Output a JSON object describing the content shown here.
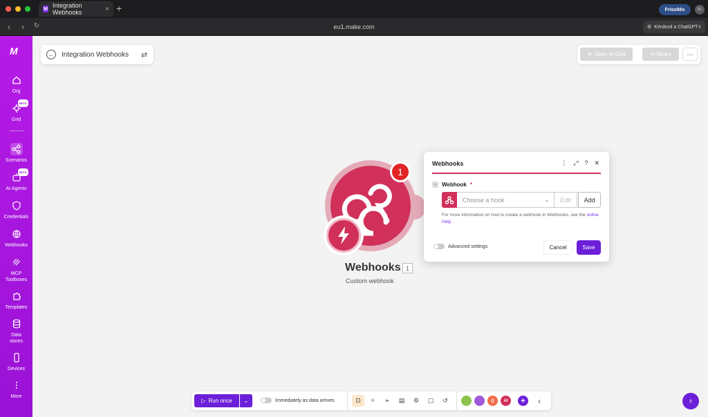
{
  "browser": {
    "tab_title": "Integration Webhooks",
    "favicon_text": "M",
    "url": "eu1.make.com",
    "update_button": "Frissítés",
    "profile_initials": "DL",
    "chatgpt_button": "Kérdezd a ChatGPT-t"
  },
  "sidebar": {
    "items": [
      {
        "label": "Org",
        "icon": "house-icon"
      },
      {
        "label": "Grid",
        "icon": "grid-icon",
        "badge": "BETA"
      },
      {
        "label": "Scenarios",
        "icon": "share-nodes-icon"
      },
      {
        "label": "AI Agents",
        "icon": "robot-icon",
        "badge": "BETA"
      },
      {
        "label": "Credentials",
        "icon": "shield-icon"
      },
      {
        "label": "Webhooks",
        "icon": "globe-icon"
      },
      {
        "label": "MCP Toolboxes",
        "icon": "mcp-icon"
      },
      {
        "label": "Templates",
        "icon": "puzzle-icon"
      },
      {
        "label": "Data stores",
        "icon": "database-icon"
      },
      {
        "label": "Devices",
        "icon": "phone-icon"
      },
      {
        "label": "More",
        "icon": "more-vertical-icon"
      }
    ]
  },
  "header": {
    "scenario_title": "Integration Webhooks",
    "open_in_grid": "Open in Grid",
    "share": "Share",
    "more": "···"
  },
  "module": {
    "name": "Webhooks",
    "number": "1",
    "subtitle": "Custom webhook",
    "run_badge": "1",
    "color": "#d0305a"
  },
  "dialog": {
    "title": "Webhooks",
    "field_label": "Webhook",
    "required_marker": "*",
    "select_placeholder": "Choose a hook",
    "edit_label": "Edit",
    "add_label": "Add",
    "help_text": "For more information on how to create a webhook in Webhooks, see the",
    "help_link": "online Help.",
    "advanced_label": "Advanced settings",
    "cancel_label": "Cancel",
    "save_label": "Save"
  },
  "bottom": {
    "run_once": "Run once",
    "schedule_label": "Immediately as data arrives",
    "apps": [
      {
        "label": "",
        "color": "#8bc34a"
      },
      {
        "label": "",
        "color": "#a05ad9"
      },
      {
        "label": "{}",
        "color": "#f06a4a"
      },
      {
        "label": "AI",
        "color": "#d0305a"
      }
    ]
  },
  "colors": {
    "brand": "#6c1fd8",
    "sidebar": "#b61be6",
    "accent": "#d0305a"
  }
}
